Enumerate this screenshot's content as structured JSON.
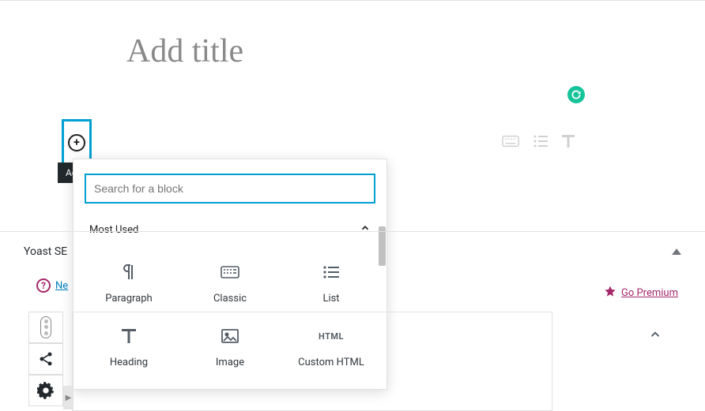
{
  "title_placeholder": "Add title",
  "tooltip": "Add block",
  "search_placeholder": "Search for a block",
  "section_label": "Most Used",
  "blocks": [
    {
      "label": "Paragraph"
    },
    {
      "label": "Classic"
    },
    {
      "label": "List"
    },
    {
      "label": "Heading"
    },
    {
      "label": "Image"
    },
    {
      "label": "Custom HTML"
    }
  ],
  "yoast": {
    "title_prefix": "Yoast SE",
    "help_link": "Ne",
    "premium": "Go Premium"
  },
  "icons": {
    "html_glyph": "HTML"
  }
}
